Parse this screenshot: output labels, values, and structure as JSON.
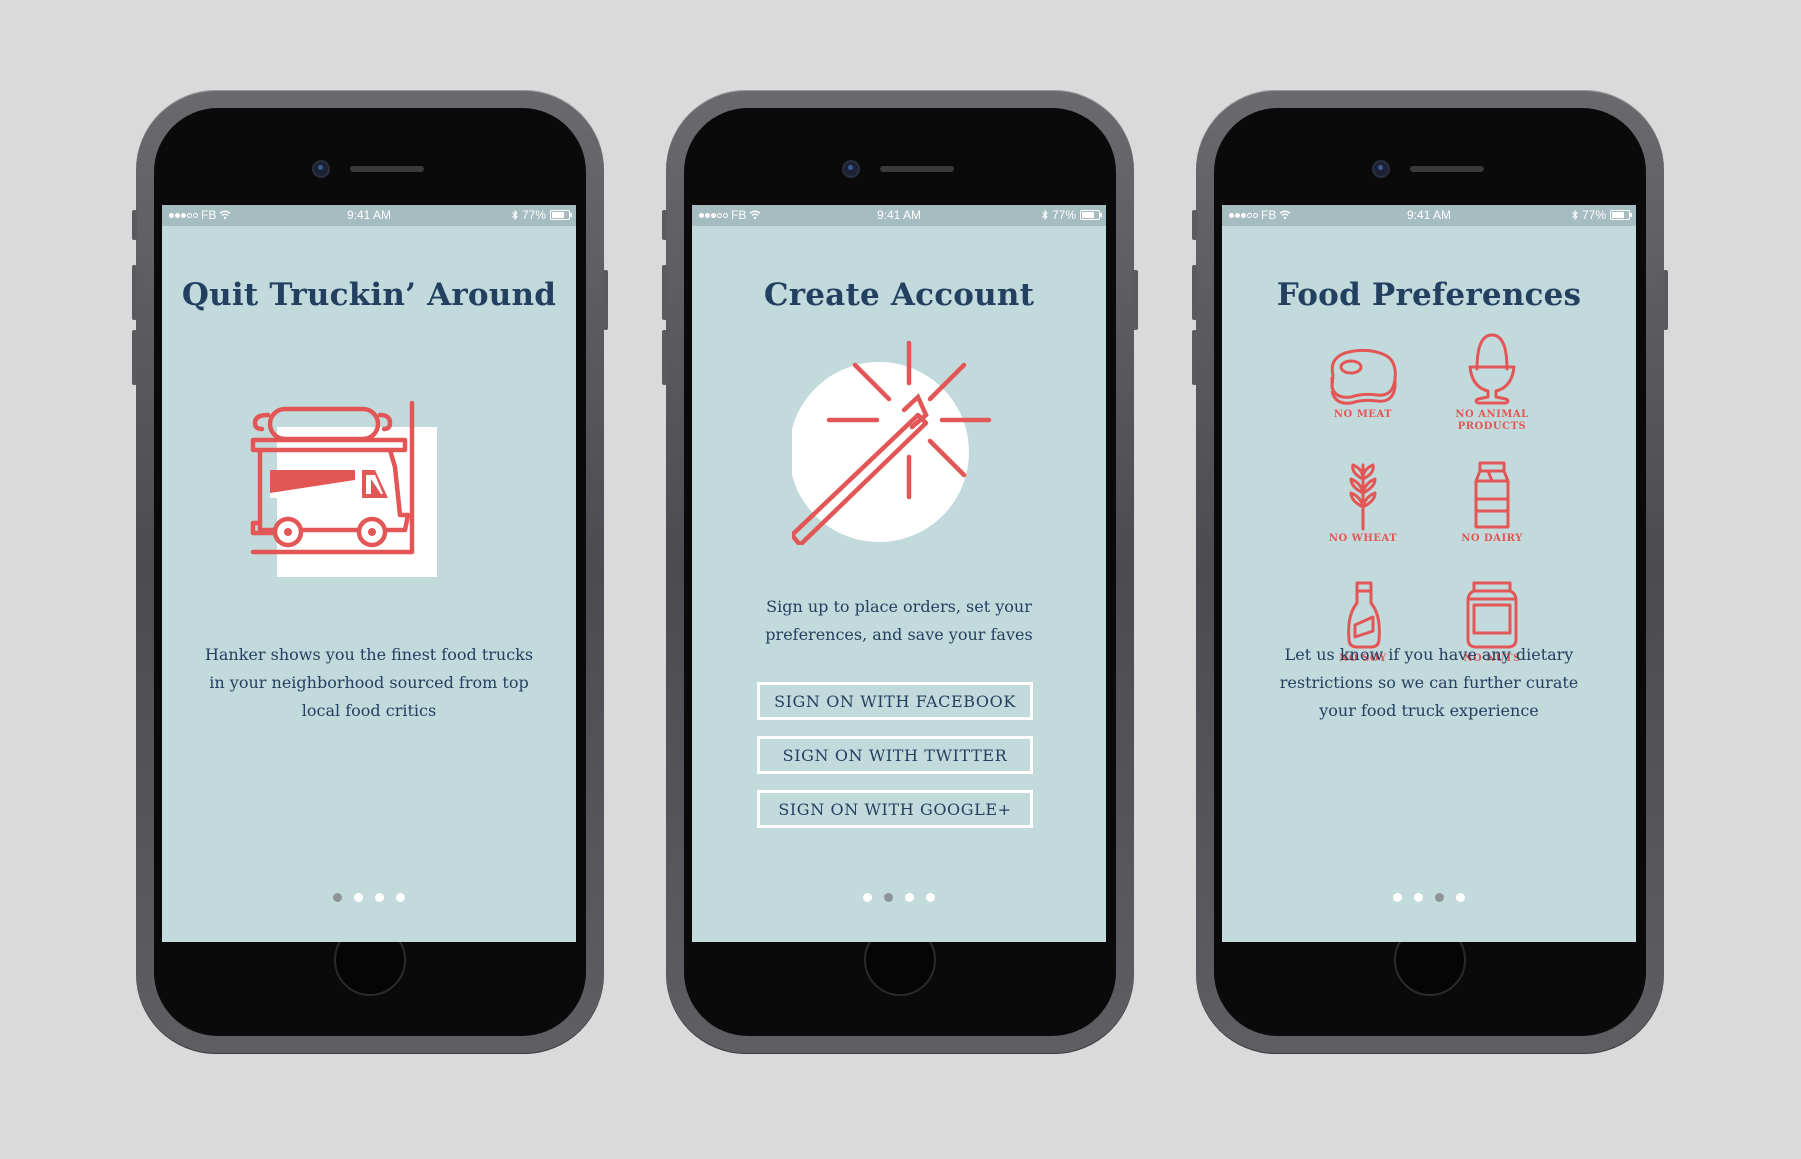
{
  "status_bar": {
    "carrier": "FB",
    "time": "9:41 AM",
    "battery": "77%"
  },
  "screens": [
    {
      "title": "Quit Truckin’ Around",
      "description": "Hanker shows you the finest food trucks in your neighborhood sourced from top local food critics",
      "illustration": "food-truck-icon",
      "pager_active": 0
    },
    {
      "title": "Create Account",
      "description": "Sign up to place orders, set your preferences, and save your faves",
      "illustration": "magic-wand-icon",
      "buttons": [
        "SIGN ON WITH FACEBOOK",
        "SIGN ON WITH TWITTER",
        "SIGN ON WITH GOOGLE+"
      ],
      "pager_active": 1
    },
    {
      "title": "Food Preferences",
      "description": "Let us know if you have any dietary restrictions so we can further curate your food truck experience",
      "preferences": [
        {
          "label": "NO MEAT",
          "icon": "steak-icon"
        },
        {
          "label": "NO ANIMAL PRODUCTS",
          "icon": "egg-icon"
        },
        {
          "label": "NO WHEAT",
          "icon": "wheat-icon"
        },
        {
          "label": "NO DAIRY",
          "icon": "milk-carton-icon"
        },
        {
          "label": "NO SOY",
          "icon": "soy-sauce-icon"
        },
        {
          "label": "NO NUTS",
          "icon": "jar-icon"
        }
      ],
      "pager_active": 2
    }
  ],
  "colors": {
    "screen_bg": "#c3dadd",
    "accent": "#e35656",
    "text": "#234060",
    "status_bg": "#a5bcc0"
  }
}
